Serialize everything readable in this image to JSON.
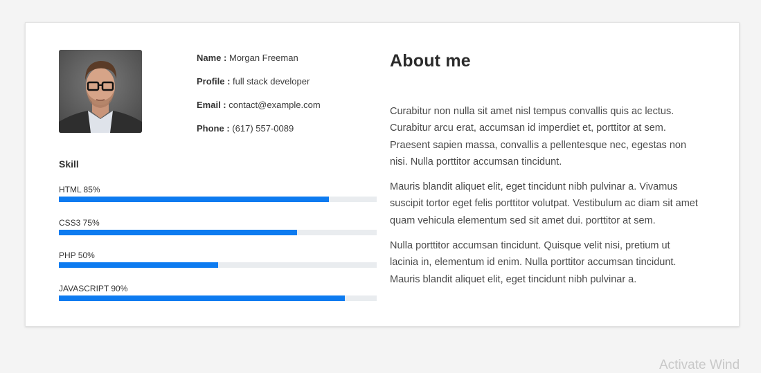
{
  "profile": {
    "name_label": "Name :",
    "name_value": "Morgan Freeman",
    "profile_label": "Profile :",
    "profile_value": "full stack developer",
    "email_label": "Email :",
    "email_value": "contact@example.com",
    "phone_label": "Phone :",
    "phone_value": "(617) 557-0089"
  },
  "skills": {
    "title": "Skill",
    "items": [
      {
        "label": "HTML 85%",
        "percent": 85
      },
      {
        "label": "CSS3 75%",
        "percent": 75
      },
      {
        "label": "PHP 50%",
        "percent": 50
      },
      {
        "label": "JAVASCRIPT 90%",
        "percent": 90
      }
    ],
    "bar_color": "#0d7bf0",
    "track_color": "#e9ecef"
  },
  "about": {
    "title": "About me",
    "paragraphs": [
      "Curabitur non nulla sit amet nisl tempus convallis quis ac lectus. Curabitur arcu erat, accumsan id imperdiet et, porttitor at sem. Praesent sapien massa, convallis a pellentesque nec, egestas non nisi. Nulla porttitor accumsan tincidunt.",
      "Mauris blandit aliquet elit, eget tincidunt nibh pulvinar a. Vivamus suscipit tortor eget felis porttitor volutpat. Vestibulum ac diam sit amet quam vehicula elementum sed sit amet dui. porttitor at sem.",
      "Nulla porttitor accumsan tincidunt. Quisque velit nisi, pretium ut lacinia in, elementum id enim. Nulla porttitor accumsan tincidunt. Mauris blandit aliquet elit, eget tincidunt nibh pulvinar a."
    ]
  },
  "watermark": "Activate Wind"
}
